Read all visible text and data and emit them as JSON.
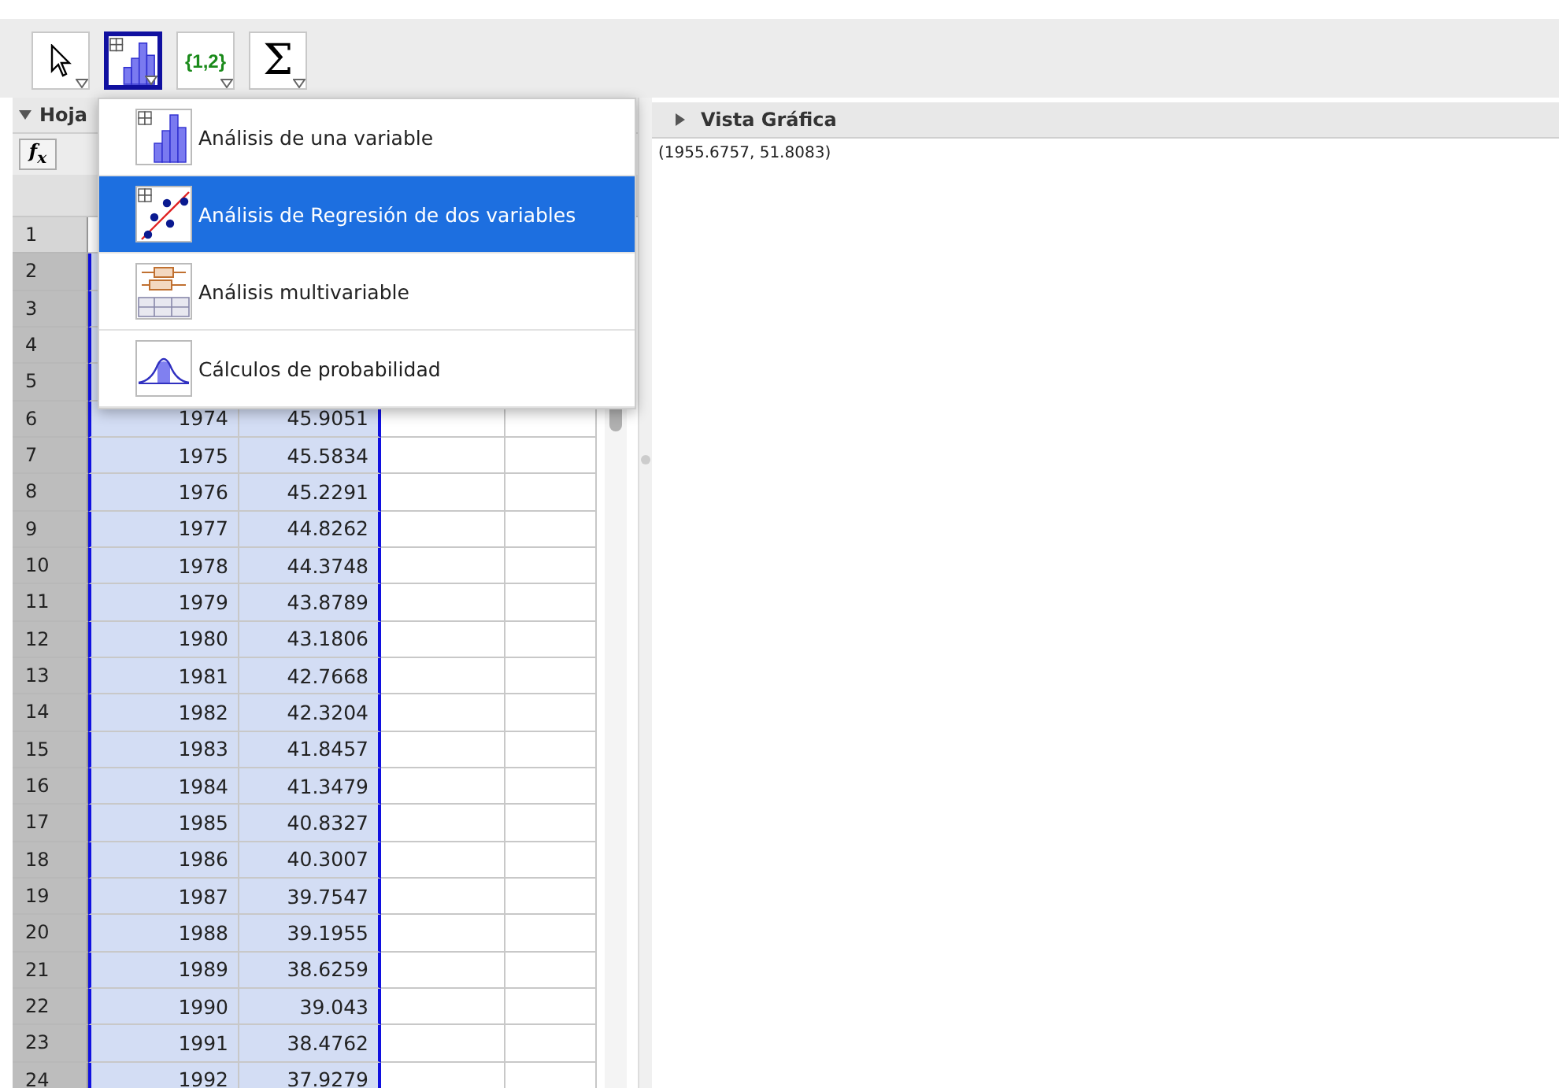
{
  "toolbar": {
    "tools": [
      {
        "kind": "pointer",
        "selected": false
      },
      {
        "kind": "stats",
        "selected": true
      },
      {
        "kind": "list",
        "label": "{1,2}",
        "selected": false
      },
      {
        "kind": "sum",
        "label": "Σ",
        "selected": false
      }
    ]
  },
  "spreadsheet": {
    "title": "Hoja",
    "fx": "f$_{x}$",
    "rows": [
      {
        "number": "1",
        "selected": false
      },
      {
        "number": "2",
        "selected": true
      },
      {
        "number": "3",
        "selected": true
      },
      {
        "number": "4",
        "selected": true
      },
      {
        "number": "5",
        "selected": true
      },
      {
        "number": "6",
        "selected": true,
        "cells": [
          "1974",
          "45.9051"
        ]
      },
      {
        "number": "7",
        "selected": true,
        "cells": [
          "1975",
          "45.5834"
        ]
      },
      {
        "number": "8",
        "selected": true,
        "cells": [
          "1976",
          "45.2291"
        ]
      },
      {
        "number": "9",
        "selected": true,
        "cells": [
          "1977",
          "44.8262"
        ]
      },
      {
        "number": "10",
        "selected": true,
        "cells": [
          "1978",
          "44.3748"
        ]
      },
      {
        "number": "11",
        "selected": true,
        "cells": [
          "1979",
          "43.8789"
        ]
      },
      {
        "number": "12",
        "selected": true,
        "cells": [
          "1980",
          "43.1806"
        ]
      },
      {
        "number": "13",
        "selected": true,
        "cells": [
          "1981",
          "42.7668"
        ]
      },
      {
        "number": "14",
        "selected": true,
        "cells": [
          "1982",
          "42.3204"
        ]
      },
      {
        "number": "15",
        "selected": true,
        "cells": [
          "1983",
          "41.8457"
        ]
      },
      {
        "number": "16",
        "selected": true,
        "cells": [
          "1984",
          "41.3479"
        ]
      },
      {
        "number": "17",
        "selected": true,
        "cells": [
          "1985",
          "40.8327"
        ]
      },
      {
        "number": "18",
        "selected": true,
        "cells": [
          "1986",
          "40.3007"
        ]
      },
      {
        "number": "19",
        "selected": true,
        "cells": [
          "1987",
          "39.7547"
        ]
      },
      {
        "number": "20",
        "selected": true,
        "cells": [
          "1988",
          "39.1955"
        ]
      },
      {
        "number": "21",
        "selected": true,
        "cells": [
          "1989",
          "38.6259"
        ]
      },
      {
        "number": "22",
        "selected": true,
        "cells": [
          "1990",
          "39.043"
        ]
      },
      {
        "number": "23",
        "selected": true,
        "cells": [
          "1991",
          "38.4762"
        ]
      },
      {
        "number": "24",
        "selected": true,
        "cells": [
          "1992",
          "37.9279"
        ]
      }
    ]
  },
  "menu": {
    "items": [
      {
        "kind": "one-variable",
        "label": "Análisis de una variable",
        "selected": false
      },
      {
        "kind": "regression",
        "label": "Análisis de Regresión de dos variables",
        "selected": true
      },
      {
        "kind": "multivariable",
        "label": "Análisis multivariable",
        "selected": false
      },
      {
        "kind": "probability",
        "label": "Cálculos de probabilidad",
        "selected": false
      }
    ]
  },
  "graphics_view": {
    "title": "Vista Gráfica",
    "coordinates": "(1955.6757, 51.8083)"
  }
}
